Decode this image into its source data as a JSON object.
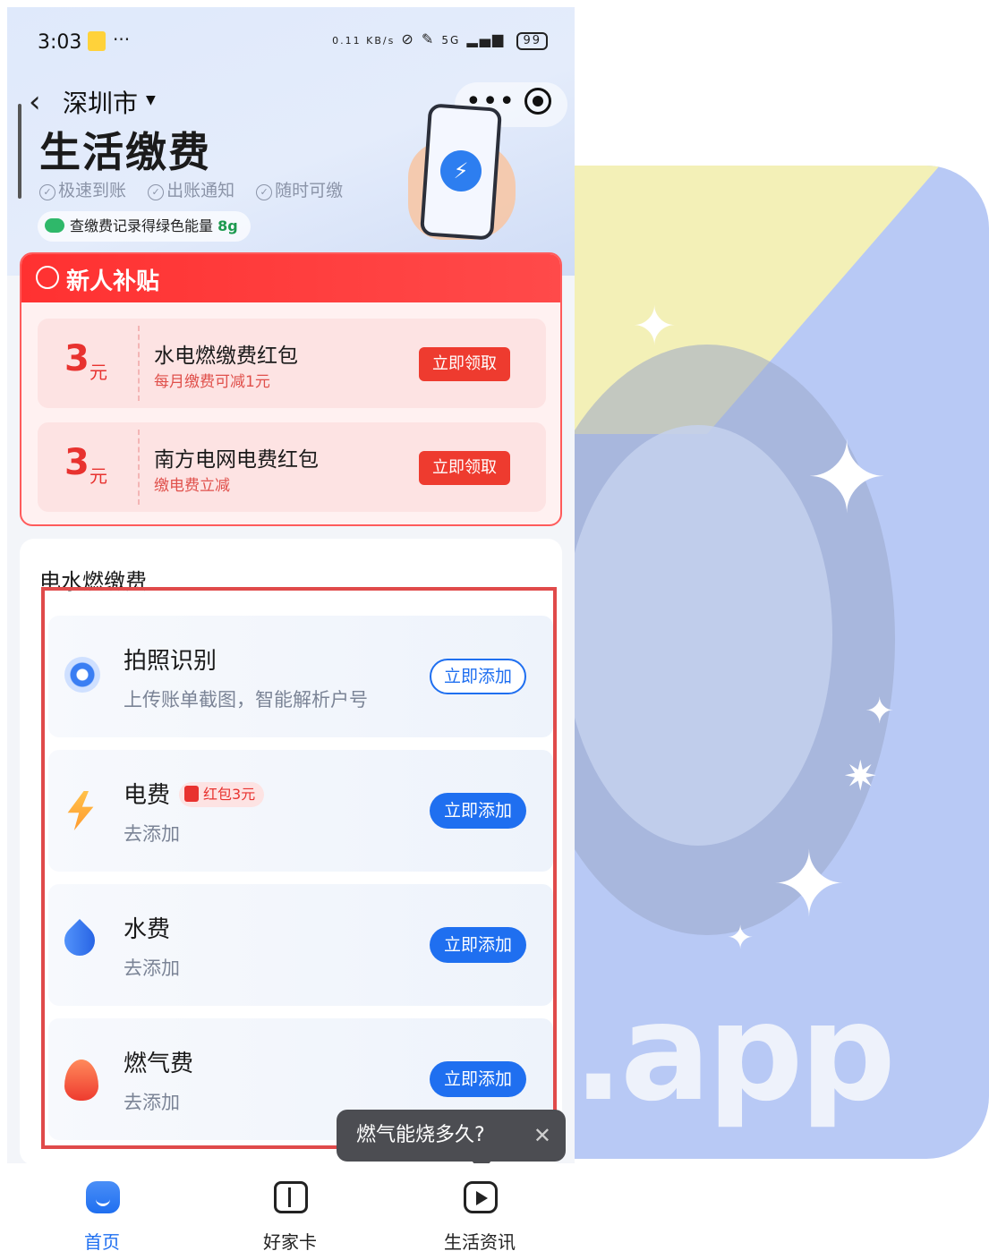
{
  "status_bar": {
    "time": "3:03",
    "dots": "···",
    "net_speed": "0.11 KB/s",
    "signal": "5G",
    "battery": "99"
  },
  "nav": {
    "city": "深圳市",
    "more": "•••"
  },
  "header": {
    "title": "生活缴费",
    "features": [
      "极速到账",
      "出账通知",
      "随时可缴"
    ],
    "energy_label": "查缴费记录得绿色能量",
    "energy_value": "8g"
  },
  "subsidy": {
    "title": "新人补贴",
    "coupons": [
      {
        "amount": "3",
        "unit": "元",
        "name": "水电燃缴费红包",
        "desc": "每月缴费可减1元",
        "button": "立即领取"
      },
      {
        "amount": "3",
        "unit": "元",
        "name": "南方电网电费红包",
        "desc": "缴电费立减",
        "button": "立即领取"
      }
    ]
  },
  "bills": {
    "section_title": "电水燃缴费",
    "rows": [
      {
        "icon": "camera-icon",
        "title": "拍照识别",
        "tag": "",
        "subtitle": "上传账单截图，智能解析户号",
        "button": "立即添加"
      },
      {
        "icon": "lightning-icon",
        "title": "电费",
        "tag": "红包3元",
        "subtitle": "去添加",
        "button": "立即添加"
      },
      {
        "icon": "water-drop-icon",
        "title": "水费",
        "tag": "",
        "subtitle": "去添加",
        "button": "立即添加"
      },
      {
        "icon": "flame-icon",
        "title": "燃气费",
        "tag": "",
        "subtitle": "去添加",
        "button": "立即添加"
      }
    ]
  },
  "tooltip": {
    "text": "燃气能烧多久?",
    "close": "✕"
  },
  "tabbar": {
    "tabs": [
      {
        "label": "首页",
        "icon": "home-icon",
        "active": true
      },
      {
        "label": "好家卡",
        "icon": "gift-icon",
        "active": false
      },
      {
        "label": "生活资讯",
        "icon": "play-icon",
        "active": false
      }
    ]
  },
  "watermark": {
    "text": ".app"
  },
  "colors": {
    "accent_blue": "#1f6ff0",
    "accent_red": "#ee3b2f",
    "highlight_border": "#e04a4a"
  }
}
